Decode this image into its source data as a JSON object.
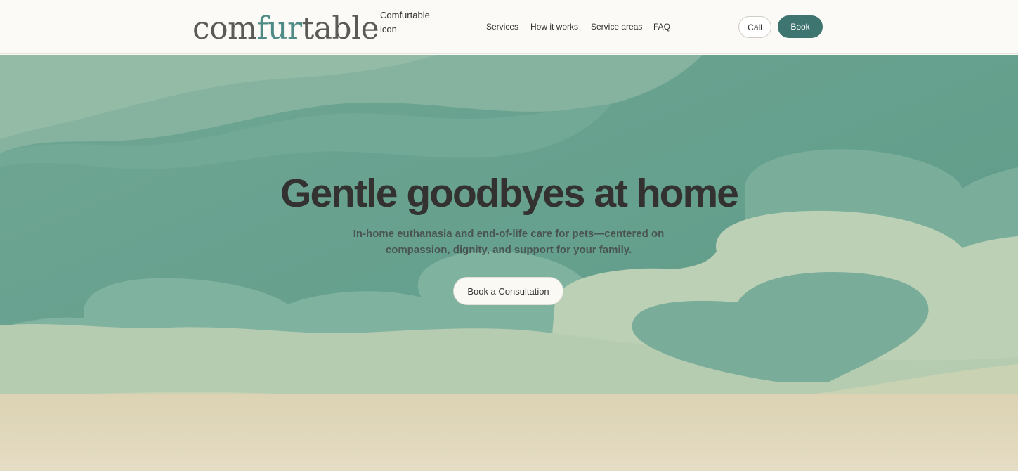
{
  "brand": {
    "logo_part1": "com",
    "logo_accent": "fur",
    "logo_part2": "table",
    "logo_alt_text": "Comfurtable icon"
  },
  "nav": {
    "items": [
      {
        "label": "Services"
      },
      {
        "label": "How it works"
      },
      {
        "label": "Service areas"
      },
      {
        "label": "FAQ"
      }
    ],
    "call_label": "Call",
    "book_label": "Book"
  },
  "hero": {
    "title": "Gentle goodbyes at home",
    "subtitle": "In-home euthanasia and end-of-life care for pets—centered on compassion, dignity, and support for your family.",
    "cta_label": "Book a Consultation"
  },
  "colors": {
    "accent": "#3f7570",
    "logo_accent": "#4e8a86",
    "background": "#fbfaf6",
    "sand": "#e0d5b8"
  },
  "icons": [
    "heart-shape"
  ]
}
